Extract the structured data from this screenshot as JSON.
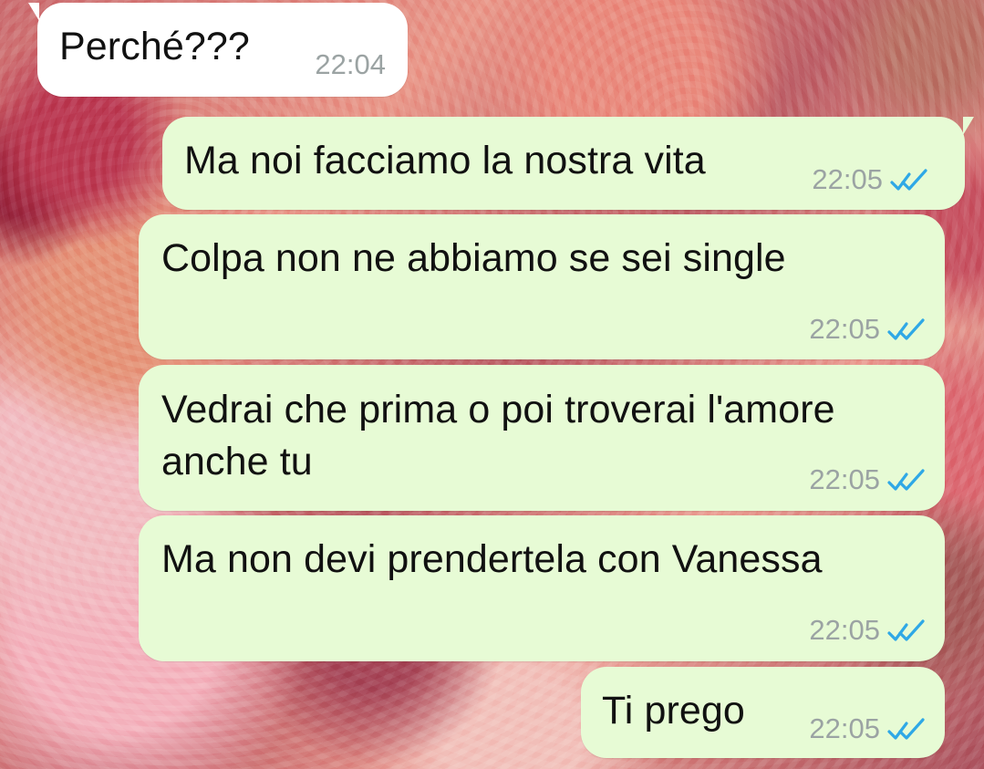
{
  "chat": {
    "messages": [
      {
        "text": "Perché???",
        "time": "22:04",
        "direction": "incoming",
        "status_icon": ""
      },
      {
        "text": "Ma noi facciamo la nostra vita",
        "time": "22:05",
        "direction": "outgoing",
        "status_icon": "double-check-icon"
      },
      {
        "text": "Colpa non ne abbiamo se sei single",
        "time": "22:05",
        "direction": "outgoing",
        "status_icon": "double-check-icon"
      },
      {
        "text": "Vedrai che prima o poi troverai l'amore anche tu",
        "time": "22:05",
        "direction": "outgoing",
        "status_icon": "double-check-icon"
      },
      {
        "text": "Ma non devi prendertela con Vanessa",
        "time": "22:05",
        "direction": "outgoing",
        "status_icon": "double-check-icon"
      },
      {
        "text": "Ti prego",
        "time": "22:05",
        "direction": "outgoing",
        "status_icon": "double-check-icon"
      }
    ]
  },
  "colors": {
    "incoming_bubble": "#ffffff",
    "outgoing_bubble": "#e7fbd5",
    "timestamp": "#9ba3a3",
    "read_check": "#2fa8e6"
  },
  "background": {
    "style": "pink roses wallpaper"
  }
}
